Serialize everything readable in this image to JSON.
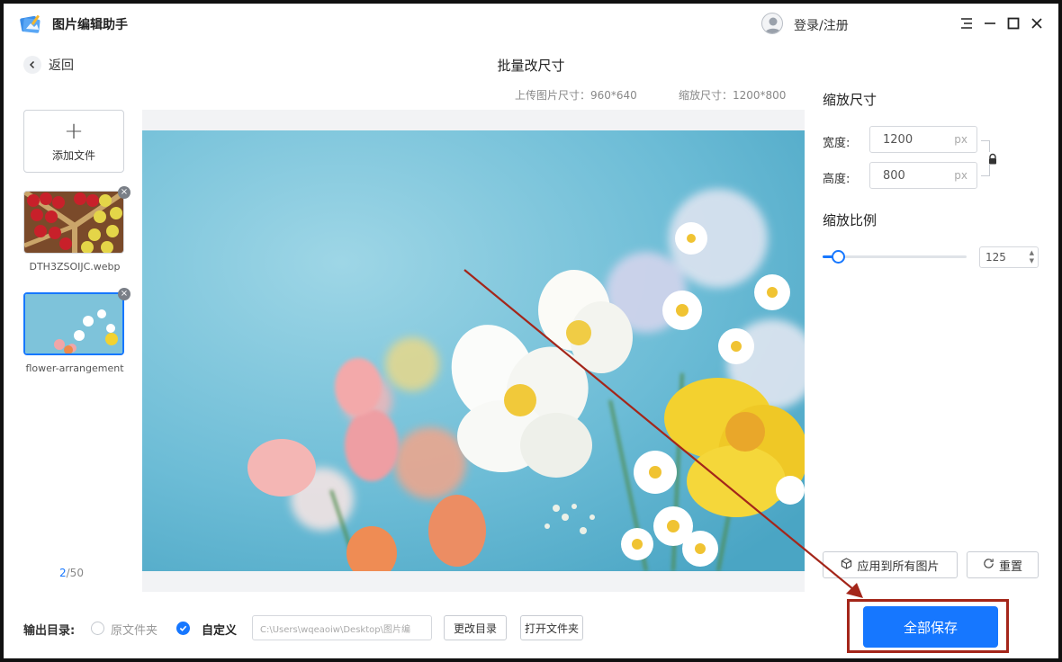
{
  "app": {
    "title": "图片编辑助手",
    "login_label": "登录/注册",
    "window_controls": [
      "menu-icon",
      "minimize-icon",
      "maximize-icon",
      "close-icon"
    ]
  },
  "header": {
    "back_label": "返回",
    "page_title": "批量改尺寸",
    "upload_size": "上传图片尺寸：960*640",
    "scaled_size": "缩放尺寸：1200*800"
  },
  "sidebar": {
    "add_file_label": "添加文件",
    "files": [
      {
        "name": "DTH3ZSOIJC.webp",
        "active": false
      },
      {
        "name": "flower-arrangement",
        "active": true
      }
    ],
    "pager_current": "2",
    "pager_total": "/50"
  },
  "settings": {
    "scale_size_title": "缩放尺寸",
    "width_label": "宽度:",
    "width_value": "1200",
    "height_label": "高度:",
    "height_value": "800",
    "unit": "px",
    "scale_ratio_title": "缩放比例",
    "scale_ratio_value": "125",
    "slider_fraction": 0.1,
    "apply_all_label": "应用到所有图片",
    "reset_label": "重置"
  },
  "output": {
    "label": "输出目录:",
    "option_original": "原文件夹",
    "option_custom": "自定义",
    "selected": "custom",
    "path_placeholder": "C:\\Users\\wqeaoiw\\Desktop\\图片编",
    "change_dir_label": "更改目录",
    "open_folder_label": "打开文件夹",
    "save_all_label": "全部保存"
  },
  "colors": {
    "accent": "#1677ff",
    "annotation": "#a4261a"
  }
}
